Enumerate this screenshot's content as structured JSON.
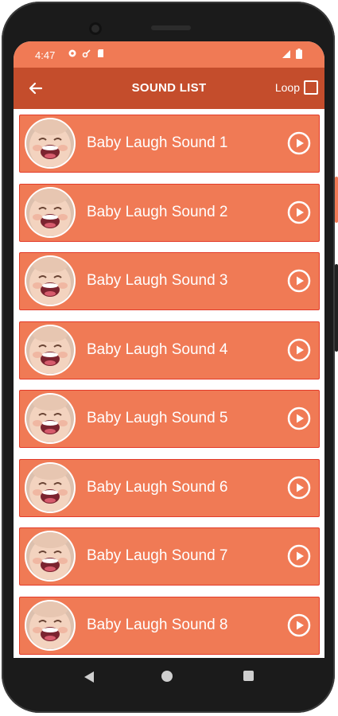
{
  "status_bar": {
    "time": "4:47",
    "icons": [
      "gear-icon",
      "key-icon",
      "sd-card-icon"
    ],
    "right_icons": [
      "signal-icon",
      "battery-icon"
    ]
  },
  "app_bar": {
    "back_icon": "arrow-left-icon",
    "title": "SOUND LIST",
    "loop_label": "Loop",
    "loop_checked": false
  },
  "sounds": [
    {
      "label": "Baby Laugh Sound 1"
    },
    {
      "label": "Baby Laugh Sound 2"
    },
    {
      "label": "Baby Laugh Sound 3"
    },
    {
      "label": "Baby Laugh Sound 4"
    },
    {
      "label": "Baby Laugh Sound 5"
    },
    {
      "label": "Baby Laugh Sound 6"
    },
    {
      "label": "Baby Laugh Sound 7"
    },
    {
      "label": "Baby Laugh Sound 8"
    }
  ],
  "nav_bar": {
    "icons": [
      "back-triangle-icon",
      "home-circle-icon",
      "recents-square-icon"
    ]
  },
  "colors": {
    "status_bar": "#f07a55",
    "app_bar": "#c44d2c",
    "item_background": "#f07a55",
    "item_border": "#e33b2a",
    "text": "#ffffff"
  }
}
